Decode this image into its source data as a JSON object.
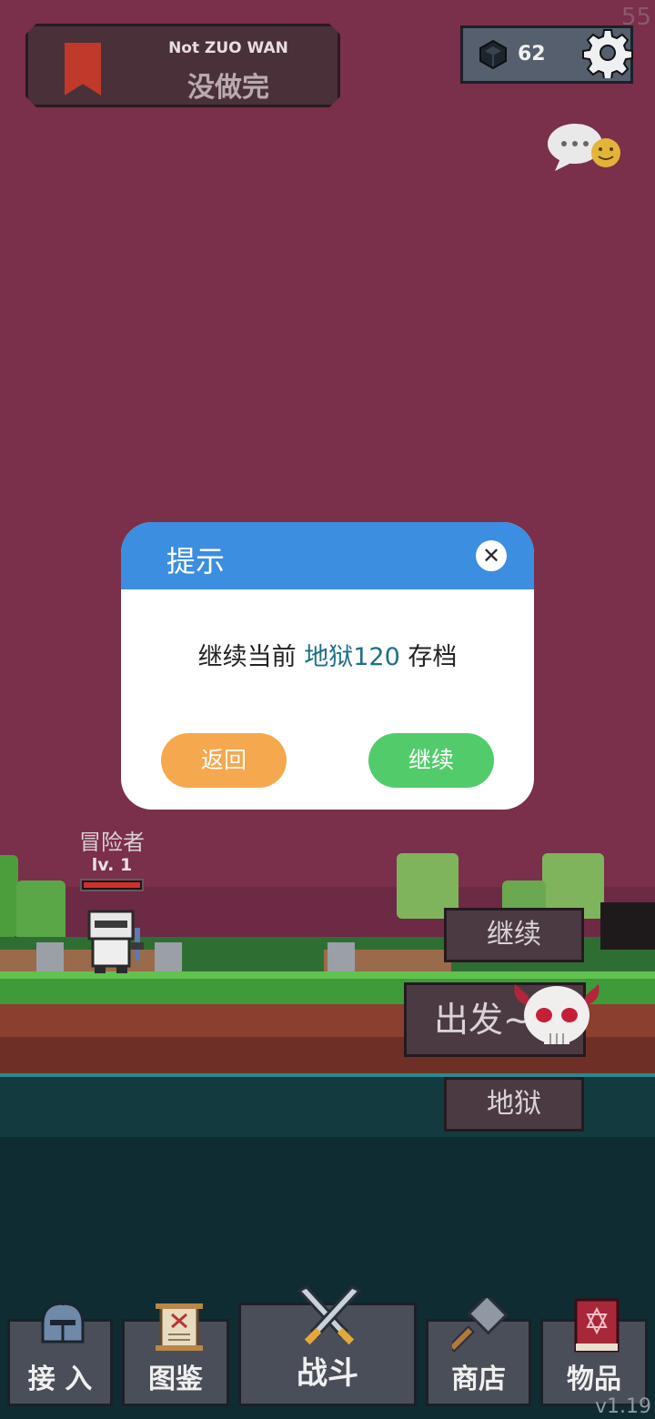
{
  "header": {
    "title_en": "Not ZUO WAN",
    "title_cn": "没做完",
    "gem_count": "62",
    "fps": "55"
  },
  "hero": {
    "name": "冒险者",
    "level": "lv. 1",
    "hp_fraction": 1.0
  },
  "scene_buttons": {
    "continue": "继续",
    "depart": "出发~",
    "hell": "地狱"
  },
  "modal": {
    "title": "提示",
    "close_symbol": "✕",
    "msg_prefix": "继续当前 ",
    "msg_highlight": "地狱120",
    "msg_suffix": " 存档",
    "back_label": "返回",
    "continue_label": "继续"
  },
  "nav": {
    "items": [
      {
        "label": "接 入"
      },
      {
        "label": "图鉴"
      },
      {
        "label": "战斗"
      },
      {
        "label": "商店"
      },
      {
        "label": "物品"
      }
    ]
  },
  "version": "v1.19",
  "colors": {
    "background": "#7a2f4b",
    "modal_header": "#3b8ee0",
    "back_button": "#f5a84d",
    "continue_button": "#52cc6a",
    "highlight_text": "#1e6f8a"
  }
}
